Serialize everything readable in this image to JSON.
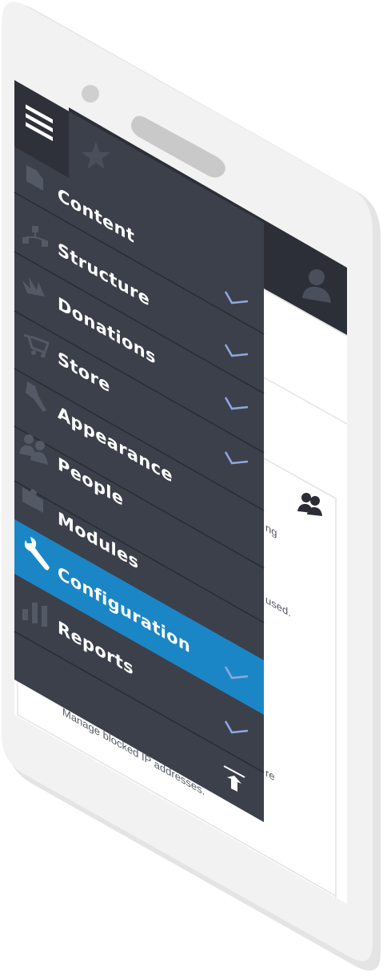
{
  "menu": {
    "items": [
      {
        "label": "Content",
        "icon": "document-icon",
        "expandable": false,
        "active": false
      },
      {
        "label": "Structure",
        "icon": "sitemap-icon",
        "expandable": true,
        "active": false
      },
      {
        "label": "Donations",
        "icon": "donation-icon",
        "expandable": true,
        "active": false
      },
      {
        "label": "Store",
        "icon": "cart-icon",
        "expandable": true,
        "active": false
      },
      {
        "label": "Appearance",
        "icon": "brush-icon",
        "expandable": true,
        "active": false
      },
      {
        "label": "People",
        "icon": "people-icon",
        "expandable": false,
        "active": false
      },
      {
        "label": "Modules",
        "icon": "puzzle-icon",
        "expandable": false,
        "active": false
      },
      {
        "label": "Configuration",
        "icon": "wrench-icon",
        "expandable": true,
        "active": true
      },
      {
        "label": "Reports",
        "icon": "bar-chart-icon",
        "expandable": true,
        "active": false
      }
    ]
  },
  "background": {
    "text_1": "ng",
    "text_2": "used.",
    "text_3": "Manage blocked IP addresses.",
    "text_4": "re"
  },
  "colors": {
    "phone_body": "#f1f1f1",
    "drawer_bg": "#3c404b",
    "toolbar_dark": "#2c2f38",
    "active_item": "#1b86c6",
    "chevron": "#8ea7e0",
    "icon_muted": "#545966"
  }
}
